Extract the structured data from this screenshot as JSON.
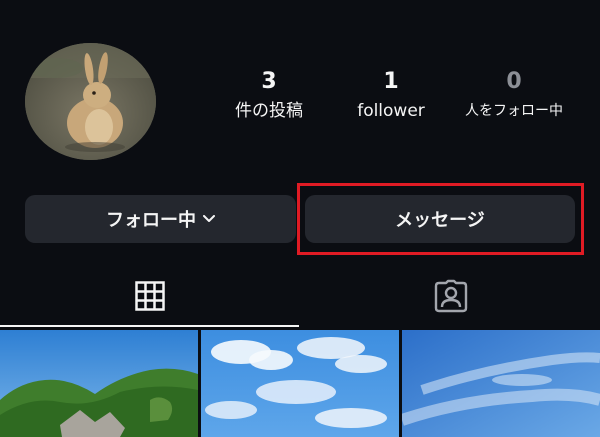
{
  "profile": {
    "stats": [
      {
        "count": "3",
        "label": "件の投稿"
      },
      {
        "count": "1",
        "label": "follower"
      },
      {
        "count": "0",
        "label": "人をフォロー中"
      }
    ]
  },
  "actions": {
    "follow_label": "フォロー中",
    "message_label": "メッセージ"
  },
  "tabs": {
    "active": "grid-icon",
    "items": [
      "grid-icon",
      "tagged-person-icon"
    ]
  },
  "colors": {
    "background": "#0b0d12",
    "button": "#24272e",
    "highlight": "#e01b24",
    "muted": "#8c8f96"
  }
}
